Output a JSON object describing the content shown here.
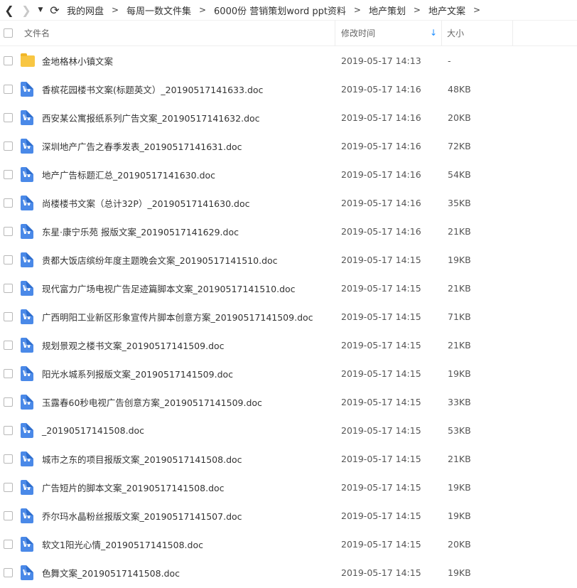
{
  "nav": {
    "back_glyph": "❮",
    "forward_glyph": "❯",
    "history_glyph": "▼",
    "refresh_glyph": "⟳"
  },
  "breadcrumb": [
    "我的网盘",
    "每周一数文件集",
    "6000份 营销策划word ppt资料",
    "地产策划",
    "地产文案"
  ],
  "breadcrumb_sep": ">",
  "columns": {
    "name": "文件名",
    "modified": "修改时间",
    "size": "大小",
    "sort_glyph": "↓"
  },
  "colors": {
    "folder": "#f8c642",
    "doc_icon": "#4a89e8",
    "sort_accent": "#1a8cff"
  },
  "files": [
    {
      "type": "folder-icon",
      "icon_text": "",
      "name": "金地格林小镇文案",
      "modified": "2019-05-17 14:13",
      "size": "-"
    },
    {
      "type": "word-doc-icon",
      "icon_text": "W",
      "name": "香槟花园楼书文案(标题英文）_20190517141633.doc",
      "modified": "2019-05-17 14:16",
      "size": "48KB"
    },
    {
      "type": "word-doc-icon",
      "icon_text": "W",
      "name": "西安某公寓报纸系列广告文案_20190517141632.doc",
      "modified": "2019-05-17 14:16",
      "size": "20KB"
    },
    {
      "type": "word-doc-icon",
      "icon_text": "W",
      "name": "深圳地产广告之春季发表_20190517141631.doc",
      "modified": "2019-05-17 14:16",
      "size": "72KB"
    },
    {
      "type": "word-doc-icon",
      "icon_text": "W",
      "name": "地产广告标题汇总_20190517141630.doc",
      "modified": "2019-05-17 14:16",
      "size": "54KB"
    },
    {
      "type": "word-doc-icon",
      "icon_text": "W",
      "name": "尚楼楼书文案（总计32P）_20190517141630.doc",
      "modified": "2019-05-17 14:16",
      "size": "35KB"
    },
    {
      "type": "word-doc-icon",
      "icon_text": "W",
      "name": "东星·康宁乐苑 报版文案_20190517141629.doc",
      "modified": "2019-05-17 14:16",
      "size": "21KB"
    },
    {
      "type": "word-doc-icon",
      "icon_text": "W",
      "name": "贵都大饭店缤纷年度主题晚会文案_20190517141510.doc",
      "modified": "2019-05-17 14:15",
      "size": "19KB"
    },
    {
      "type": "word-doc-icon",
      "icon_text": "W",
      "name": "现代富力广场电视广告足迹篇脚本文案_20190517141510.doc",
      "modified": "2019-05-17 14:15",
      "size": "21KB"
    },
    {
      "type": "word-doc-icon",
      "icon_text": "W",
      "name": "广西明阳工业新区形象宣传片脚本创意方案_20190517141509.doc",
      "modified": "2019-05-17 14:15",
      "size": "71KB"
    },
    {
      "type": "word-doc-icon",
      "icon_text": "W",
      "name": "规划景观之楼书文案_20190517141509.doc",
      "modified": "2019-05-17 14:15",
      "size": "21KB"
    },
    {
      "type": "word-doc-icon",
      "icon_text": "W",
      "name": "阳光水城系列报版文案_20190517141509.doc",
      "modified": "2019-05-17 14:15",
      "size": "19KB"
    },
    {
      "type": "word-doc-icon",
      "icon_text": "W",
      "name": "玉露春60秒电视广告创意方案_20190517141509.doc",
      "modified": "2019-05-17 14:15",
      "size": "33KB"
    },
    {
      "type": "word-doc-icon",
      "icon_text": "W",
      "name": "_20190517141508.doc",
      "modified": "2019-05-17 14:15",
      "size": "53KB"
    },
    {
      "type": "word-doc-icon",
      "icon_text": "W",
      "name": "城市之东的项目报版文案_20190517141508.doc",
      "modified": "2019-05-17 14:15",
      "size": "21KB"
    },
    {
      "type": "word-doc-icon",
      "icon_text": "W",
      "name": "广告短片的脚本文案_20190517141508.doc",
      "modified": "2019-05-17 14:15",
      "size": "19KB"
    },
    {
      "type": "word-doc-icon",
      "icon_text": "W",
      "name": "乔尔玛水晶粉丝报版文案_20190517141507.doc",
      "modified": "2019-05-17 14:15",
      "size": "19KB"
    },
    {
      "type": "word-doc-icon",
      "icon_text": "W",
      "name": "软文1阳光心情_20190517141508.doc",
      "modified": "2019-05-17 14:15",
      "size": "20KB"
    },
    {
      "type": "word-doc-icon",
      "icon_text": "W",
      "name": "色舞文案_20190517141508.doc",
      "modified": "2019-05-17 14:15",
      "size": "19KB"
    }
  ]
}
